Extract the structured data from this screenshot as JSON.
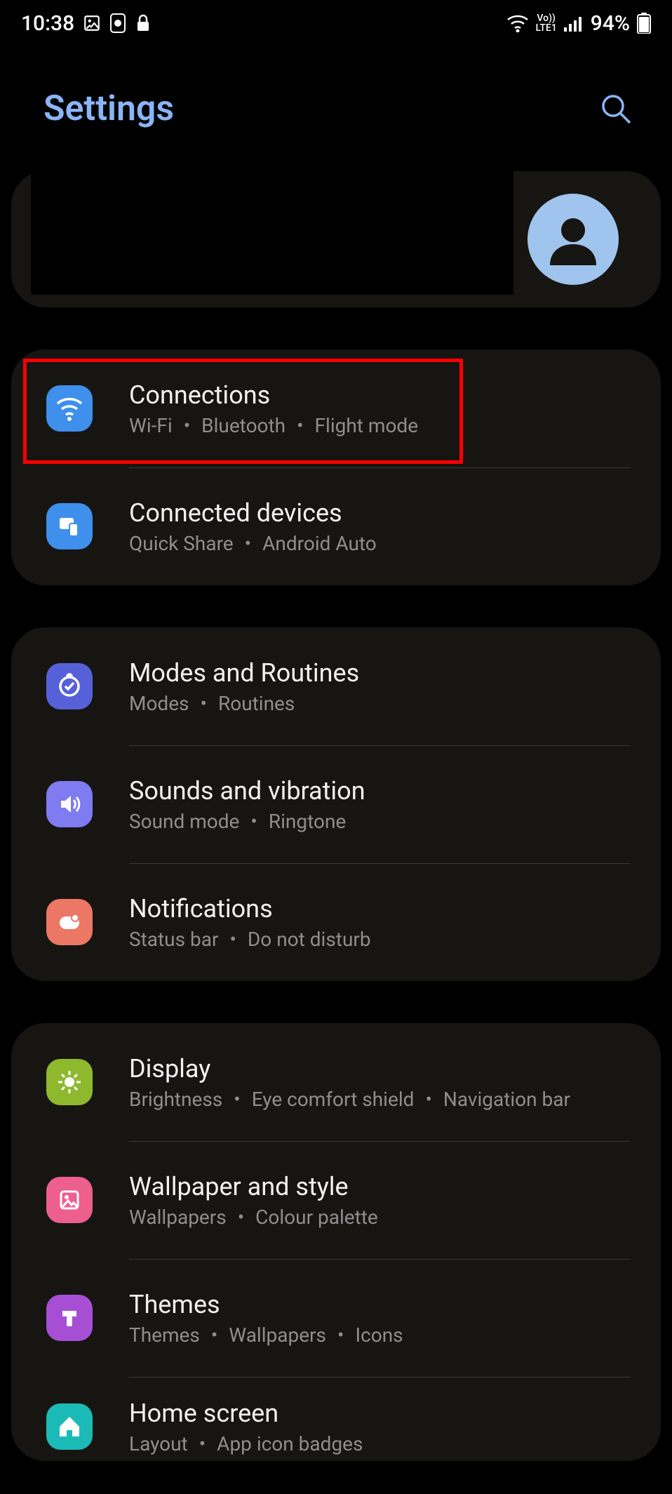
{
  "status": {
    "time": "10:38",
    "battery": "94%",
    "net_label": "LTE1",
    "vo_label": "Vo))"
  },
  "header": {
    "title": "Settings"
  },
  "groups": [
    {
      "items": [
        {
          "id": "connections",
          "title": "Connections",
          "subs": [
            "Wi-Fi",
            "Bluetooth",
            "Flight mode"
          ]
        },
        {
          "id": "connected-devices",
          "title": "Connected devices",
          "subs": [
            "Quick Share",
            "Android Auto"
          ]
        }
      ]
    },
    {
      "items": [
        {
          "id": "modes",
          "title": "Modes and Routines",
          "subs": [
            "Modes",
            "Routines"
          ]
        },
        {
          "id": "sounds",
          "title": "Sounds and vibration",
          "subs": [
            "Sound mode",
            "Ringtone"
          ]
        },
        {
          "id": "notifications",
          "title": "Notifications",
          "subs": [
            "Status bar",
            "Do not disturb"
          ]
        }
      ]
    },
    {
      "items": [
        {
          "id": "display",
          "title": "Display",
          "subs": [
            "Brightness",
            "Eye comfort shield",
            "Navigation bar"
          ]
        },
        {
          "id": "wallpaper",
          "title": "Wallpaper and style",
          "subs": [
            "Wallpapers",
            "Colour palette"
          ]
        },
        {
          "id": "themes",
          "title": "Themes",
          "subs": [
            "Themes",
            "Wallpapers",
            "Icons"
          ]
        },
        {
          "id": "home",
          "title": "Home screen",
          "subs": [
            "Layout",
            "App icon badges"
          ]
        }
      ]
    }
  ]
}
